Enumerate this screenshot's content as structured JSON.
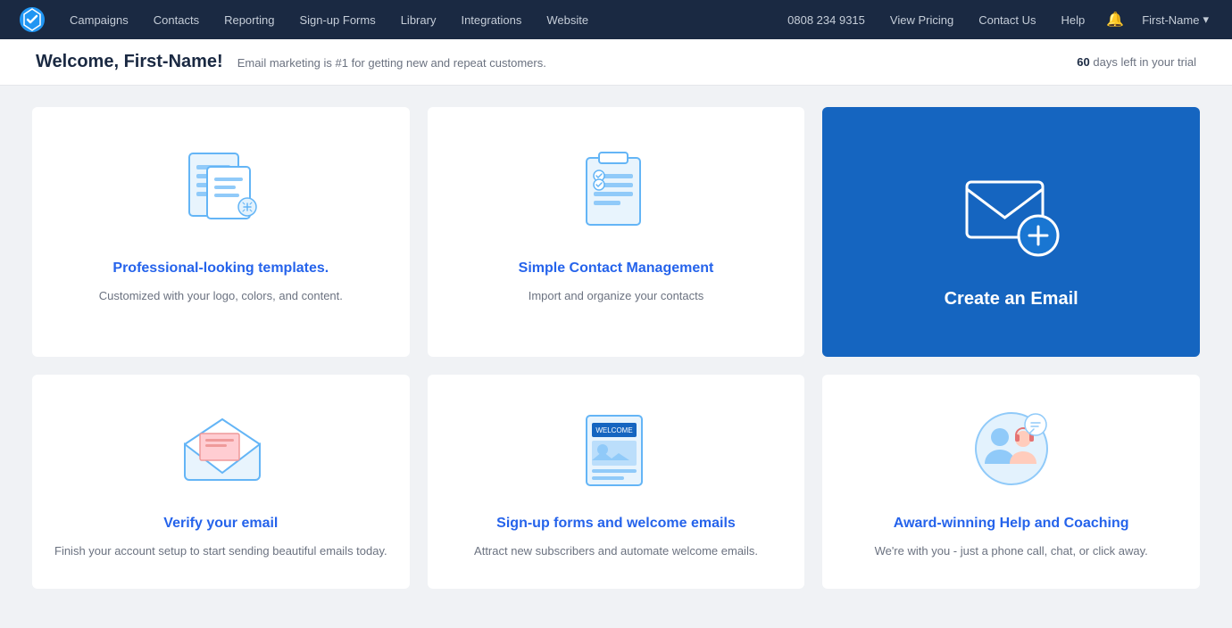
{
  "nav": {
    "logo_alt": "Campaigner logo",
    "links": [
      {
        "label": "Campaigns",
        "name": "campaigns"
      },
      {
        "label": "Contacts",
        "name": "contacts"
      },
      {
        "label": "Reporting",
        "name": "reporting"
      },
      {
        "label": "Sign-up Forms",
        "name": "signup-forms"
      },
      {
        "label": "Library",
        "name": "library"
      },
      {
        "label": "Integrations",
        "name": "integrations"
      },
      {
        "label": "Website",
        "name": "website"
      }
    ],
    "phone": "0808 234 9315",
    "view_pricing": "View Pricing",
    "contact_us": "Contact Us",
    "help": "Help",
    "user_name": "First-Name"
  },
  "header": {
    "welcome_prefix": "Welcome, ",
    "user_name": "First-Name!",
    "subtitle": "Email marketing is #1 for getting new and repeat customers.",
    "trial_prefix": "60",
    "trial_suffix": "days left in your trial"
  },
  "cards": {
    "row1": [
      {
        "name": "templates-card",
        "title": "Professional-looking templates.",
        "desc": "Customized with your logo, colors, and content."
      },
      {
        "name": "contacts-card",
        "title": "Simple Contact Management",
        "desc": "Import and organize your contacts"
      }
    ],
    "featured": {
      "name": "create-email-card",
      "title": "Create an Email"
    },
    "row2": [
      {
        "name": "verify-email-card",
        "title": "Verify your email",
        "desc": "Finish your account setup to start sending beautiful emails today."
      },
      {
        "name": "signup-forms-card",
        "title": "Sign-up forms and welcome emails",
        "desc": "Attract new subscribers and automate welcome emails."
      },
      {
        "name": "help-coaching-card",
        "title": "Award-winning Help and Coaching",
        "desc": "We're with you - just a phone call, chat, or click away."
      }
    ]
  },
  "colors": {
    "accent": "#2563eb",
    "featured_bg": "#1565c0",
    "icon_blue": "#3b82f6",
    "icon_light": "#93c5fd"
  }
}
